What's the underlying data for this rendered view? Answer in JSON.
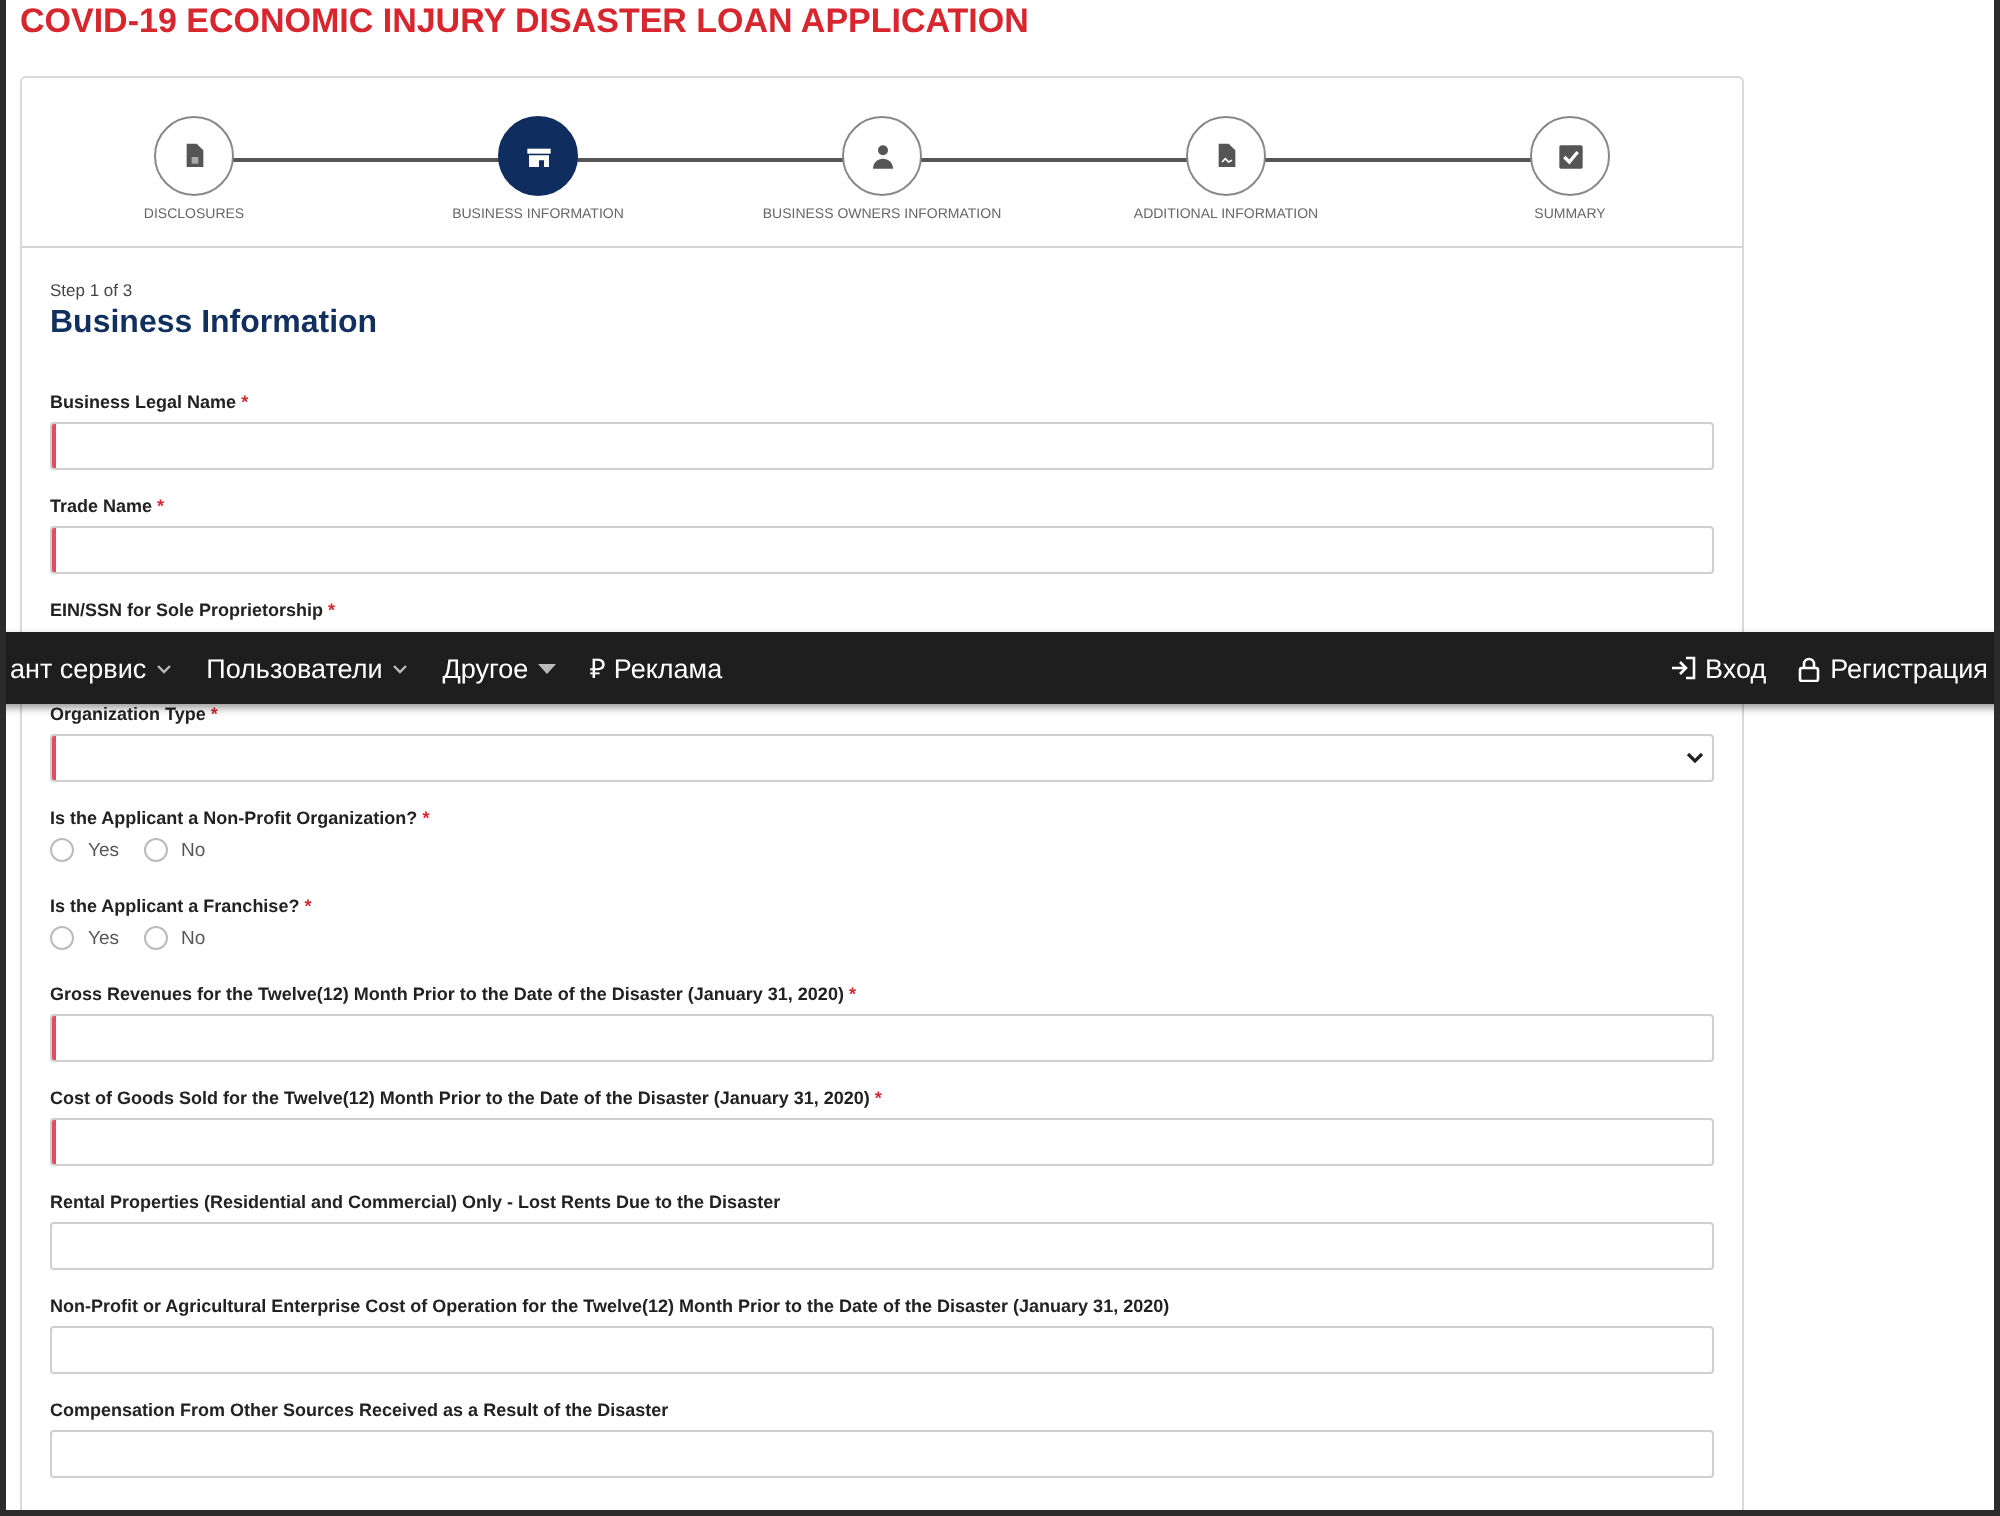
{
  "page_title": "COVID-19 ECONOMIC INJURY DISASTER LOAN APPLICATION",
  "steps": [
    {
      "label": "DISCLOSURES",
      "selected": false
    },
    {
      "label": "BUSINESS INFORMATION",
      "selected": true
    },
    {
      "label": "BUSINESS OWNERS INFORMATION",
      "selected": false
    },
    {
      "label": "ADDITIONAL INFORMATION",
      "selected": false
    },
    {
      "label": "SUMMARY",
      "selected": false
    }
  ],
  "step_counter": "Step 1 of 3",
  "section_title": "Business Information",
  "fields": [
    {
      "kind": "text",
      "label": "Business Legal Name",
      "required_mark": "*",
      "invalid": true
    },
    {
      "kind": "text",
      "label": "Trade Name",
      "required_mark": "*",
      "invalid": true
    },
    {
      "kind": "label",
      "label": "EIN/SSN for Sole Proprietorship",
      "required_mark": "*"
    },
    {
      "kind": "select",
      "label": "Organization Type",
      "required_mark": "*",
      "invalid": true
    },
    {
      "kind": "radio",
      "label": "Is the Applicant a Non-Profit Organization?",
      "required_mark": "*",
      "options": [
        {
          "label": "Yes",
          "selected": false
        },
        {
          "label": "No",
          "selected": false
        }
      ]
    },
    {
      "kind": "radio",
      "label": "Is the Applicant a Franchise?",
      "required_mark": "*",
      "options": [
        {
          "label": "Yes",
          "selected": false
        },
        {
          "label": "No",
          "selected": false
        }
      ]
    },
    {
      "kind": "text",
      "label": "Gross Revenues for the Twelve(12) Month Prior to the Date of the Disaster (January 31, 2020)",
      "required_mark": "*",
      "invalid": true
    },
    {
      "kind": "text",
      "label": "Cost of Goods Sold for the Twelve(12) Month Prior to the Date of the Disaster (January 31, 2020)",
      "required_mark": "*",
      "invalid": true
    },
    {
      "kind": "text",
      "label": "Rental Properties (Residential and Commercial) Only - Lost Rents Due to the Disaster",
      "invalid": false
    },
    {
      "kind": "text",
      "label": "Non-Profit or Agricultural Enterprise Cost of Operation for the Twelve(12) Month Prior to the Date of the Disaster (January 31, 2020)",
      "invalid": false
    },
    {
      "kind": "text",
      "label": "Compensation From Other Sources Received as a Result of the Disaster",
      "invalid": false
    }
  ],
  "overlay_nav": {
    "left": [
      {
        "label": "ант сервис",
        "kind": "dropdown"
      },
      {
        "label": "Пользователи",
        "kind": "dropdown"
      },
      {
        "label": "Другое",
        "kind": "menu"
      },
      {
        "label": "₽ Реклама",
        "kind": "link"
      }
    ],
    "right": [
      {
        "label": "Вход",
        "kind": "login"
      },
      {
        "label": "Регистрация",
        "kind": "register"
      }
    ]
  }
}
